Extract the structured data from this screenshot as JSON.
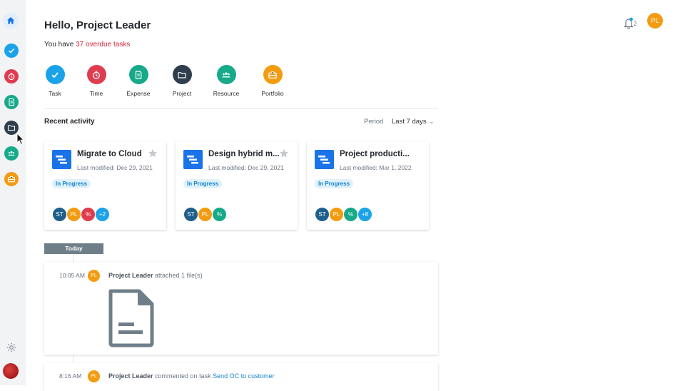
{
  "header": {
    "greeting": "Hello, Project Leader",
    "overdue_prefix": "You have ",
    "overdue_link": "37 overdue tasks",
    "notification_count": "2",
    "user_initials": "PL"
  },
  "sidebar": {
    "items": [
      {
        "name": "home",
        "color": "#1a73e8"
      },
      {
        "name": "task",
        "color": "#1aa3e8"
      },
      {
        "name": "time",
        "color": "#e03c4f"
      },
      {
        "name": "expense",
        "color": "#16a98a"
      },
      {
        "name": "project",
        "color": "#2f3e4c"
      },
      {
        "name": "resource",
        "color": "#16a98a"
      },
      {
        "name": "portfolio",
        "color": "#f39c12"
      }
    ]
  },
  "quick_actions": [
    {
      "label": "Task",
      "color": "#1aa3e8",
      "icon": "check-icon"
    },
    {
      "label": "Time",
      "color": "#e03c4f",
      "icon": "timer-icon"
    },
    {
      "label": "Expense",
      "color": "#16a98a",
      "icon": "receipt-icon"
    },
    {
      "label": "Project",
      "color": "#2f3e4c",
      "icon": "folder-icon"
    },
    {
      "label": "Resource",
      "color": "#16a98a",
      "icon": "people-icon"
    },
    {
      "label": "Portfolio",
      "color": "#f39c12",
      "icon": "briefcase-icon"
    }
  ],
  "recent": {
    "title": "Recent activity",
    "period_label": "Period",
    "period_value": "Last 7 days"
  },
  "cards": [
    {
      "title": "Migrate to Cloud",
      "modified": "Last modified: Dec 29, 2021",
      "status": "In Progress",
      "members": [
        {
          "initials": "ST",
          "color": "#1f5f8b"
        },
        {
          "initials": "PL",
          "color": "#f39c12"
        },
        {
          "initials": "%",
          "color": "#e03c4f"
        },
        {
          "initials": "+2",
          "color": "#1aa3e8"
        }
      ]
    },
    {
      "title": "Design hybrid m...",
      "modified": "Last modified: Dec 29, 2021",
      "status": "In Progress",
      "members": [
        {
          "initials": "ST",
          "color": "#1f5f8b"
        },
        {
          "initials": "PL",
          "color": "#f39c12"
        },
        {
          "initials": "%",
          "color": "#16a98a"
        }
      ]
    },
    {
      "title": "Project producti...",
      "modified": "Last modified: Mar 1, 2022",
      "status": "In Progress",
      "members": [
        {
          "initials": "ST",
          "color": "#1f5f8b"
        },
        {
          "initials": "PL",
          "color": "#f39c12"
        },
        {
          "initials": "%",
          "color": "#16a98a"
        },
        {
          "initials": "+8",
          "color": "#1aa3e8"
        }
      ]
    }
  ],
  "timeline": {
    "day_label": "Today",
    "entries": [
      {
        "time": "10:05 AM",
        "initials": "PL",
        "actor": "Project Leader",
        "action": " attached 1 file(s)",
        "task": ""
      },
      {
        "time": "8:16 AM",
        "initials": "PL",
        "actor": "Project Leader",
        "action": " commented on task ",
        "task": "Send OC to customer"
      }
    ]
  }
}
